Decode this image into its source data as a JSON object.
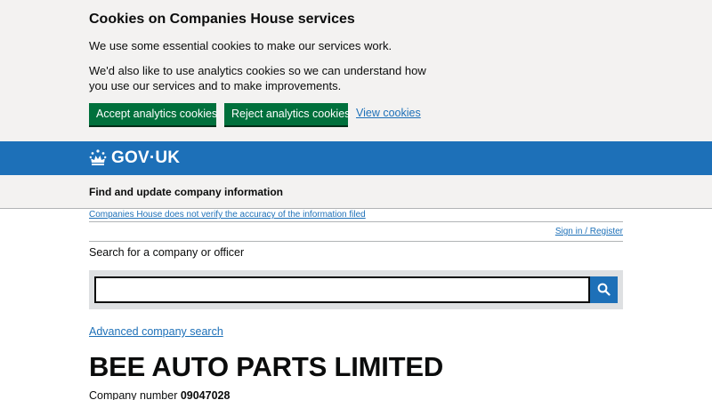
{
  "cookie_banner": {
    "title": "Cookies on Companies House services",
    "paragraph_1": "We use some essential cookies to make our services work.",
    "paragraph_2": "We'd also like to use analytics cookies so we can understand how you use our services and to make improvements.",
    "accept_label": "Accept analytics cookies",
    "reject_label": "Reject analytics cookies",
    "view_label": "View cookies"
  },
  "header": {
    "logo_text": "GOV·UK",
    "service_name": "Find and update company information"
  },
  "notices": {
    "disclaimer": "Companies House does not verify the accuracy of the information filed",
    "sign_in": "Sign in / Register"
  },
  "search": {
    "label": "Search for a company or officer",
    "value": "",
    "advanced_link": "Advanced company search"
  },
  "company": {
    "name": "BEE AUTO PARTS LIMITED",
    "number_label": "Company number",
    "number": "09047028"
  },
  "colors": {
    "link": "#1d70b8",
    "button_green": "#00703c",
    "header_blue": "#1d70b8",
    "banner_grey": "#f3f2f1"
  },
  "icons": {
    "logo": "crown-icon",
    "search": "search-icon"
  }
}
